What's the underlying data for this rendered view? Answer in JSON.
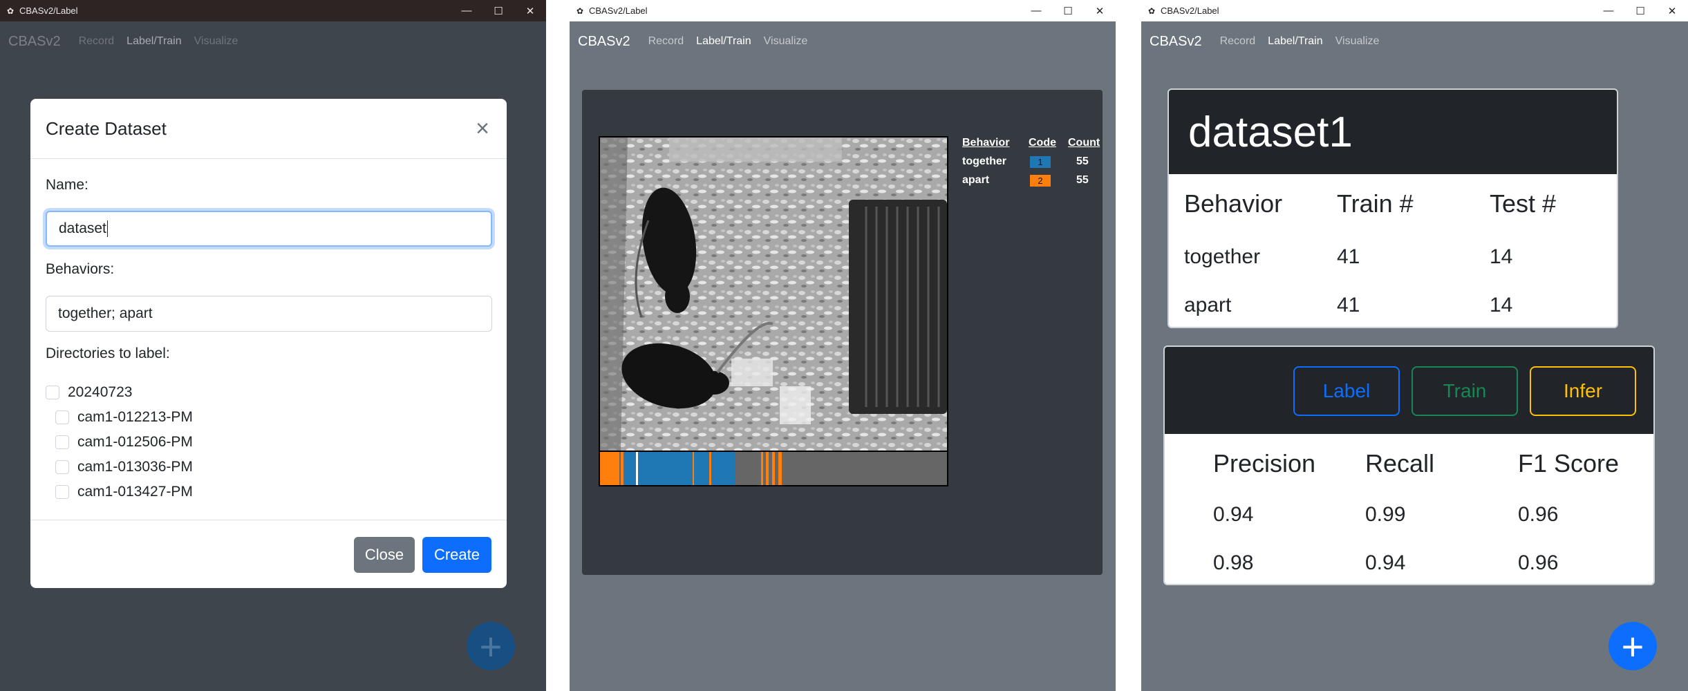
{
  "windows": [
    {
      "title": "CBASv2/Label",
      "brand": "CBASv2",
      "nav": [
        "Record",
        "Label/Train",
        "Visualize"
      ]
    },
    {
      "title": "CBASv2/Label",
      "brand": "CBASv2",
      "nav": [
        "Record",
        "Label/Train",
        "Visualize"
      ]
    },
    {
      "title": "CBASv2/Label",
      "brand": "CBASv2",
      "nav": [
        "Record",
        "Label/Train",
        "Visualize"
      ]
    }
  ],
  "window_controls": {
    "minimize": "—",
    "maximize": "☐",
    "close": "✕"
  },
  "create_dialog": {
    "title": "Create Dataset",
    "name_label": "Name:",
    "name_value": "dataset",
    "behaviors_label": "Behaviors:",
    "behaviors_value": "together; apart",
    "directories_label": "Directories to label:",
    "directories": [
      {
        "label": "20240723",
        "checked": false
      },
      {
        "label": "cam1-012213-PM",
        "checked": false
      },
      {
        "label": "cam1-012506-PM",
        "checked": false
      },
      {
        "label": "cam1-013036-PM",
        "checked": false
      },
      {
        "label": "cam1-013427-PM",
        "checked": false
      }
    ],
    "close_button": "Close",
    "create_button": "Create"
  },
  "labeler": {
    "legend_headers": [
      "Behavior",
      "Code",
      "Count"
    ],
    "legend_rows": [
      {
        "behavior": "together",
        "code": "1",
        "count": "55",
        "color": "#1f77b4"
      },
      {
        "behavior": "apart",
        "code": "2",
        "count": "55",
        "color": "#ff7f0e"
      }
    ]
  },
  "dataset_card": {
    "name": "dataset1",
    "headers": [
      "Behavior",
      "Train #",
      "Test #"
    ],
    "rows": [
      [
        "together",
        "41",
        "14"
      ],
      [
        "apart",
        "41",
        "14"
      ]
    ]
  },
  "model_card": {
    "buttons": [
      "Label",
      "Train",
      "Infer"
    ],
    "button_colors": [
      "#0d6efd",
      "#198754",
      "#ffc107"
    ],
    "headers": [
      "Precision",
      "Recall",
      "F1 Score"
    ],
    "rows": [
      [
        "0.94",
        "0.99",
        "0.96"
      ],
      [
        "0.98",
        "0.94",
        "0.96"
      ]
    ]
  },
  "colors": {
    "primary": "#0d6efd",
    "secondary": "#6c757d",
    "dark": "#212529",
    "together": "#1f77b4",
    "apart": "#ff7f0e"
  }
}
